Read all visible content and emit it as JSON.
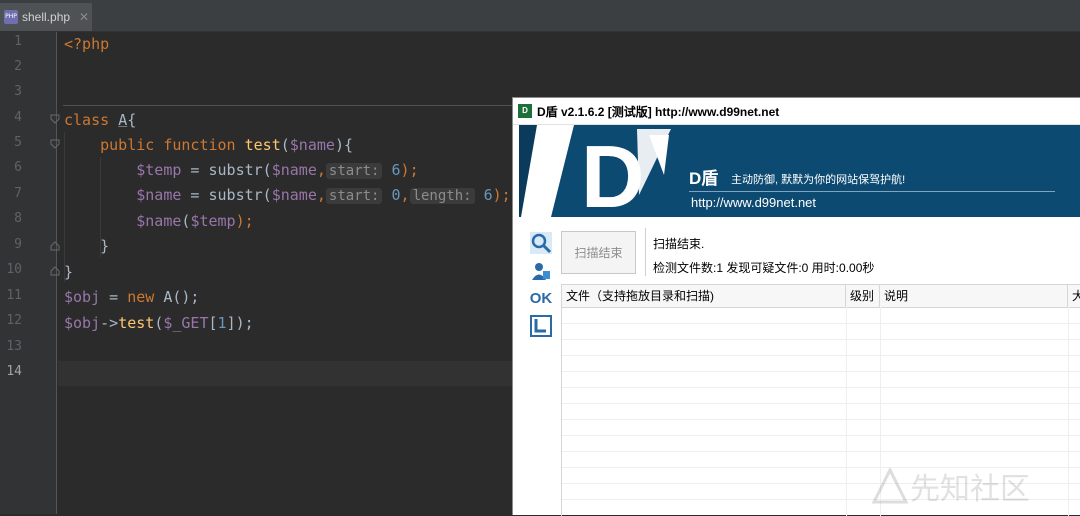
{
  "ide": {
    "tab_label": "shell.php",
    "tab_icon": "php-file-icon",
    "close_glyph": "✕",
    "line_numbers": [
      "1",
      "2",
      "3",
      "4",
      "5",
      "6",
      "7",
      "8",
      "9",
      "10",
      "11",
      "12",
      "13",
      "14"
    ],
    "current_line": "14"
  },
  "code": {
    "l1_tag": "<?php",
    "l4_kw": "class",
    "l4_name": "A",
    "l4_brace": "{",
    "l5_public": "public",
    "l5_function": "function",
    "l5_fn": "test",
    "l5_open": "(",
    "l5_param": "$name",
    "l5_close": "){",
    "l6_var": "$temp",
    "l6_eq": " = substr(",
    "l6_arg": "$name",
    "l6_comma": ",",
    "l6_hint": "start:",
    "l6_num": "6",
    "l6_end": ");",
    "l7_var": "$name",
    "l7_eq": " = substr(",
    "l7_arg": "$name",
    "l7_comma": ",",
    "l7_hint1": "start:",
    "l7_num1": "0",
    "l7_comma2": ",",
    "l7_hint2": "length:",
    "l7_num2": "6",
    "l7_end": ");",
    "l8_var": "$name",
    "l8_open": "(",
    "l8_arg": "$temp",
    "l8_end": ");",
    "l9": "}",
    "l10": "}",
    "l11_var": "$obj",
    "l11_eq": " = ",
    "l11_new": "new",
    "l11_rest": " A();",
    "l12_var": "$obj",
    "l12_arrow": "->",
    "l12_fn": "test",
    "l12_open": "(",
    "l12_get": "$_GET",
    "l12_br1": "[",
    "l12_num": "1",
    "l12_end": "]);"
  },
  "dshield": {
    "title": "D盾 v2.1.6.2 [测试版] http://www.d99net.net",
    "banner_brand": "D盾",
    "banner_slogan": "主动防御, 默默为你的网站保驾护航!",
    "banner_url": "http://www.d99net.net",
    "scan_button": "扫描结束",
    "status_line1": "扫描结束.",
    "status_line2": "检测文件数:1 发现可疑文件:0 用时:0.00秒",
    "sidebar_icons": [
      "search-icon",
      "user-shield-icon",
      "ok-icon",
      "file-frame-icon"
    ],
    "ok_label": "OK",
    "columns": [
      "文件（支持拖放目录和扫描)",
      "级别",
      "说明",
      "大"
    ],
    "accent": "#0d4a72"
  },
  "watermark": "先知社区"
}
